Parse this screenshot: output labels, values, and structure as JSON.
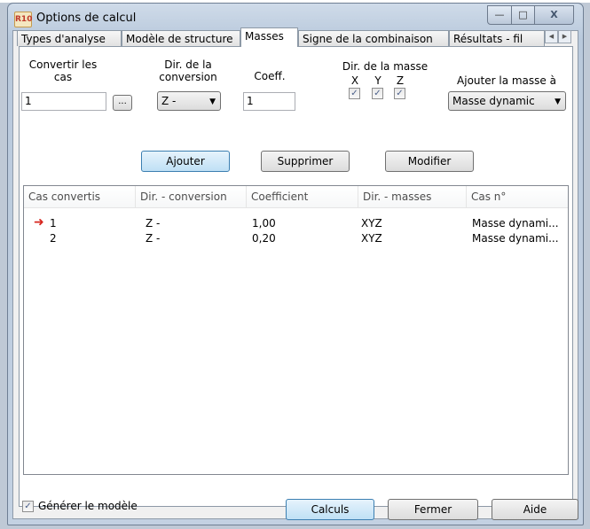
{
  "window": {
    "icon_text": "R10",
    "title": "Options de calcul",
    "min_glyph": "—",
    "max_glyph": "□",
    "close_glyph": "X"
  },
  "tabs": [
    {
      "label": "Types d'analyse",
      "active": false
    },
    {
      "label": "Modèle de structure",
      "active": false
    },
    {
      "label": "Masses",
      "active": true
    },
    {
      "label": "Signe de la combinaison",
      "active": false
    },
    {
      "label": "Résultats - fil",
      "active": false
    }
  ],
  "tab_scroll": {
    "left": "◀",
    "right": "▶"
  },
  "form": {
    "convert_label_1": "Convertir les",
    "convert_label_2": "cas",
    "convert_value": "1",
    "browse_label": "...",
    "dir_conv_label_1": "Dir. de la",
    "dir_conv_label_2": "conversion",
    "dir_conv_value": "Z -",
    "coeff_label": "Coeff.",
    "coeff_value": "1",
    "dir_mass_label": "Dir. de la masse",
    "axis_x": "X",
    "axis_y": "Y",
    "axis_z": "Z",
    "add_mass_label": "Ajouter la masse à",
    "add_mass_value": "Masse dynamic"
  },
  "buttons": {
    "add": "Ajouter",
    "delete": "Supprimer",
    "modify": "Modifier"
  },
  "table": {
    "columns": [
      "Cas convertis",
      "Dir. - conversion",
      "Coefficient",
      "Dir. - masses",
      "Cas n°"
    ],
    "rows": [
      [
        "1",
        "Z -",
        "1,00",
        "XYZ",
        "Masse dynami..."
      ],
      [
        "2",
        "Z -",
        "0,20",
        "XYZ",
        "Masse dynami..."
      ]
    ]
  },
  "footer": {
    "generate_label": "Générer le modèle",
    "calc": "Calculs",
    "close": "Fermer",
    "help": "Aide"
  },
  "check_mark": "✓",
  "current_row_marker": "➜"
}
